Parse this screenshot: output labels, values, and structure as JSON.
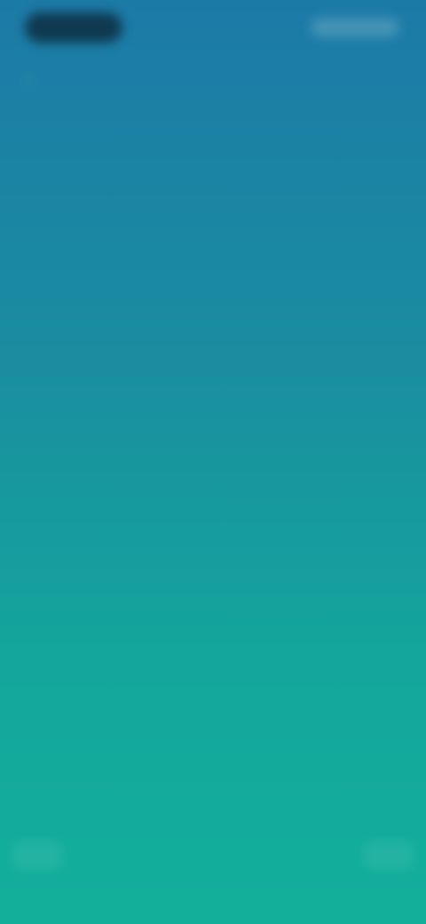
{
  "status_bar": {
    "pill_color": "#0e2e42"
  },
  "nav": {
    "back_icon": "chevron-left-icon"
  },
  "gradient": {
    "top": "#1c7aa7",
    "bottom": "#12b09b"
  }
}
